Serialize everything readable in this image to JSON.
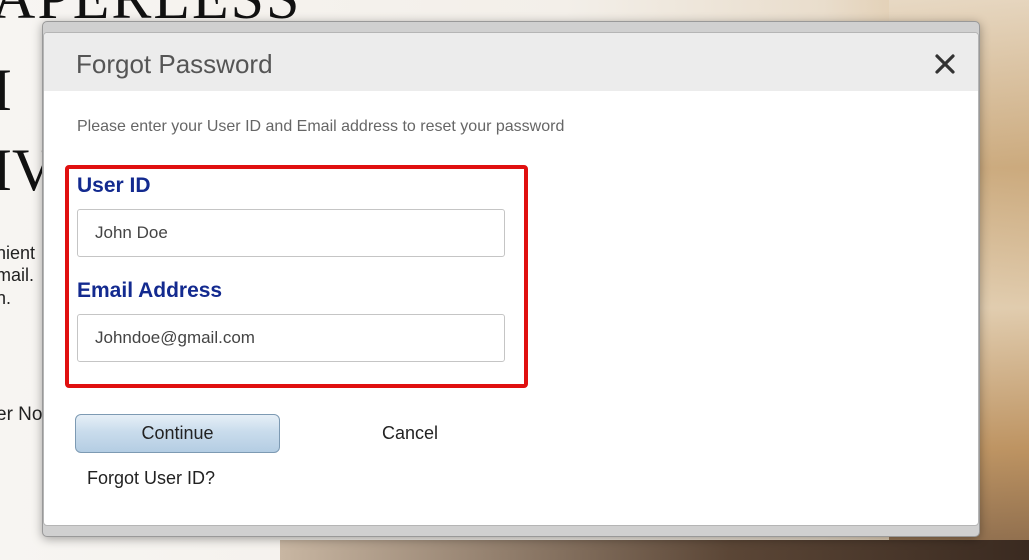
{
  "background": {
    "headline_lines": [
      "APERLESS",
      "I",
      "IV"
    ],
    "fragment_lines": [
      "nient",
      "mail.",
      "n.",
      "er No"
    ]
  },
  "dialog": {
    "title": "Forgot Password",
    "close_icon": "close-icon",
    "instructions": "Please enter your User ID and Email address to reset your password",
    "highlight_color": "#e01010",
    "label_color": "#132a8f",
    "fields": {
      "user_id": {
        "label": "User ID",
        "value": "John Doe"
      },
      "email": {
        "label": "Email Address",
        "value": "Johndoe@gmail.com"
      }
    },
    "buttons": {
      "continue_label": "Continue",
      "cancel_label": "Cancel"
    },
    "forgot_user_id_label": "Forgot User ID?"
  }
}
